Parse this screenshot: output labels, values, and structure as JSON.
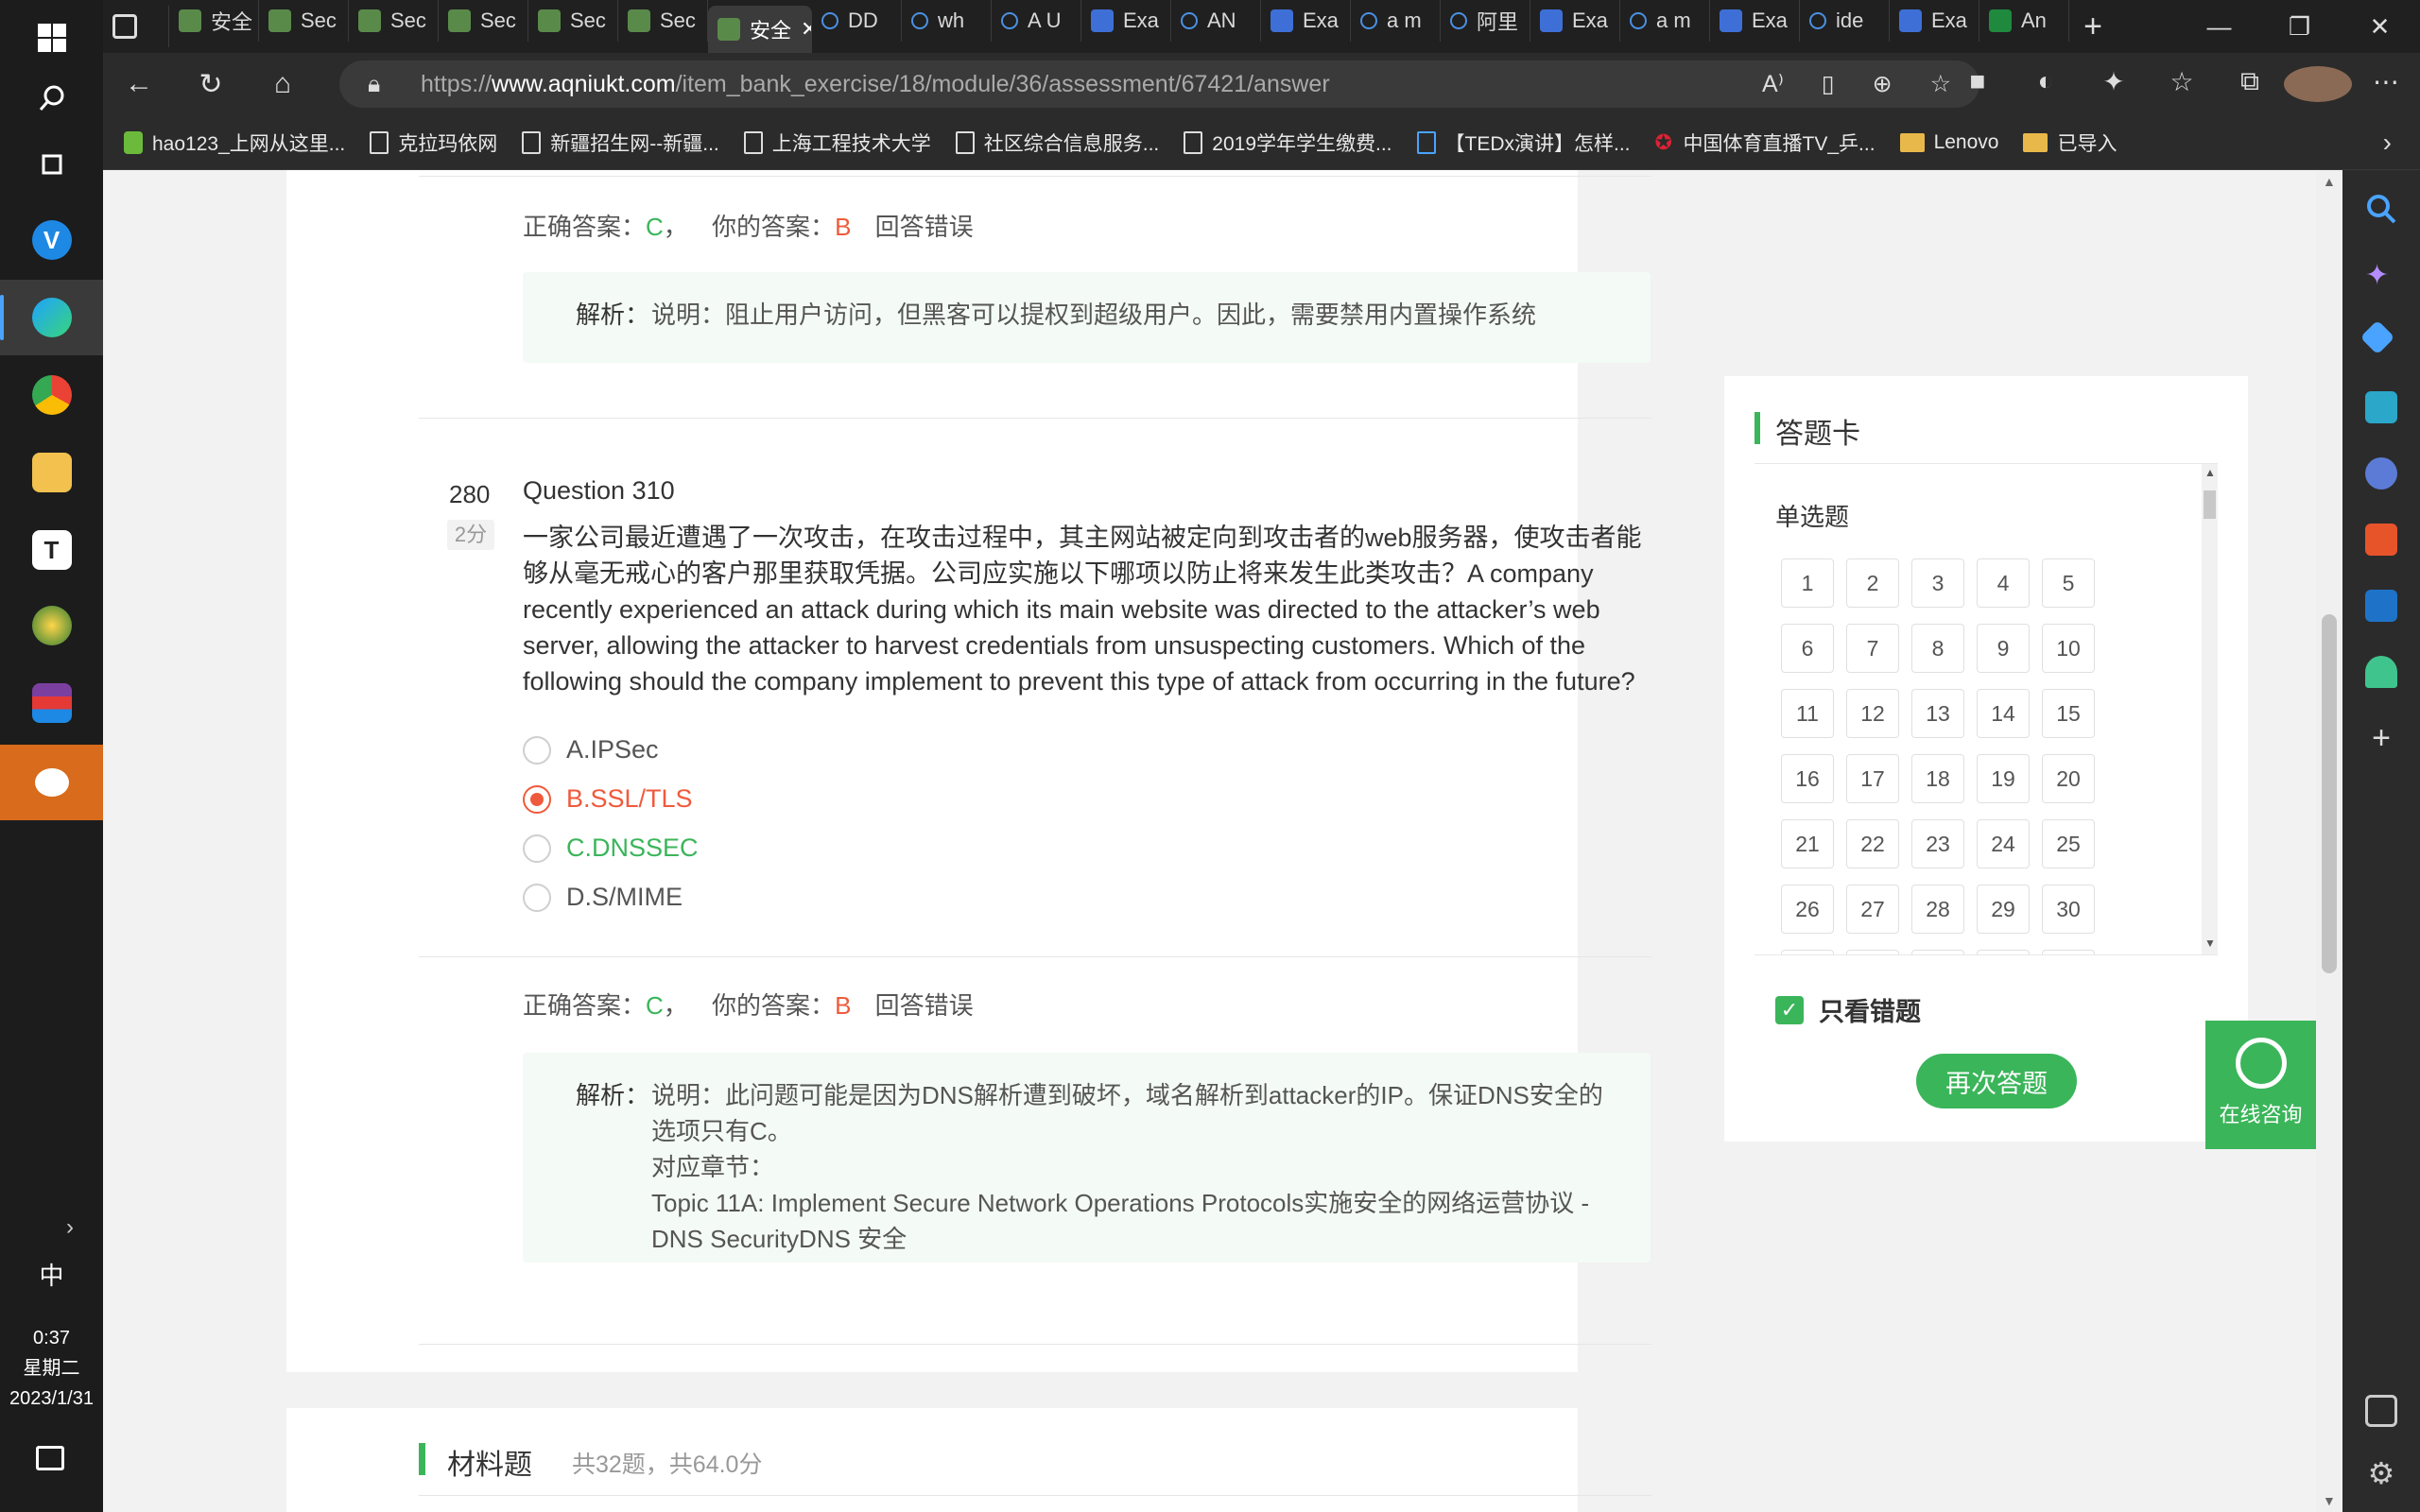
{
  "taskbar": {
    "time": "0:37",
    "weekday": "星期二",
    "date": "2023/1/31",
    "ime": "中",
    "chevron": "›"
  },
  "browser": {
    "tabs": [
      {
        "label": "安全",
        "icon": "shield-icon"
      },
      {
        "label": "Sec",
        "icon": "shield-icon"
      },
      {
        "label": "Sec",
        "icon": "shield-icon"
      },
      {
        "label": "Sec",
        "icon": "shield-icon"
      },
      {
        "label": "Sec",
        "icon": "shield-icon"
      },
      {
        "label": "Sec",
        "icon": "shield-icon"
      },
      {
        "label": "安全",
        "icon": "shield-icon",
        "active": true
      },
      {
        "label": "DD",
        "icon": "search-icon"
      },
      {
        "label": "wh",
        "icon": "search-icon"
      },
      {
        "label": "A U",
        "icon": "search-icon"
      },
      {
        "label": "Exa",
        "icon": "doc-icon"
      },
      {
        "label": "AN",
        "icon": "search-icon"
      },
      {
        "label": "Exa",
        "icon": "doc-icon"
      },
      {
        "label": "a m",
        "icon": "search-icon"
      },
      {
        "label": "阿里",
        "icon": "search-icon"
      },
      {
        "label": "Exa",
        "icon": "doc-icon"
      },
      {
        "label": "a m",
        "icon": "search-icon"
      },
      {
        "label": "Exa",
        "icon": "doc-icon"
      },
      {
        "label": "ide",
        "icon": "search-icon"
      },
      {
        "label": "Exa",
        "icon": "doc-icon"
      },
      {
        "label": "An",
        "icon": "leetcode-icon"
      }
    ],
    "url_prefix": "https://",
    "url_domain": "www.aqniukt.com",
    "url_path": "/item_bank_exercise/18/module/36/assessment/67421/answer",
    "bookmarks": [
      {
        "label": "hao123_上网从这里...",
        "icon": "hao123-icon"
      },
      {
        "label": "克拉玛依网",
        "icon": "page-icon"
      },
      {
        "label": "新疆招生网--新疆...",
        "icon": "page-icon"
      },
      {
        "label": "上海工程技术大学",
        "icon": "page-icon"
      },
      {
        "label": "社区综合信息服务...",
        "icon": "page-icon"
      },
      {
        "label": "2019学年学生缴费...",
        "icon": "page-icon"
      },
      {
        "label": "【TEDx演讲】怎样...",
        "icon": "tv-icon"
      },
      {
        "label": "中国体育直播TV_乒...",
        "icon": "cn-icon"
      },
      {
        "label": "Lenovo",
        "icon": "folder-icon"
      },
      {
        "label": "已导入",
        "icon": "folder-icon"
      }
    ]
  },
  "prev_question": {
    "correct_label": "正确答案：",
    "correct_value": "C",
    "sep": "，",
    "your_label": "你的答案：",
    "your_value": "B",
    "result": "回答错误",
    "analysis_label": "解析：",
    "analysis_text": "说明：阻止用户访问，但黑客可以提权到超级用户。因此，需要禁用内置操作系统"
  },
  "question": {
    "number": "280",
    "score": "2分",
    "title": "Question 310",
    "text": "一家公司最近遭遇了一次攻击，在攻击过程中，其主网站被定向到攻击者的web服务器，使攻击者能够从毫无戒心的客户那里获取凭据。公司应实施以下哪项以防止将来发生此类攻击？A company recently experienced an attack during which its main website was directed to the attacker’s web server, allowing the attacker to harvest credentials from unsuspecting customers. Which of the following should the company implement to prevent this type of attack from occurring in the future?",
    "options": [
      {
        "label": "A.IPSec",
        "state": "none"
      },
      {
        "label": "B.SSL/TLS",
        "state": "selected"
      },
      {
        "label": "C.DNSSEC",
        "state": "correct"
      },
      {
        "label": "D.S/MIME",
        "state": "none"
      }
    ],
    "correct_label": "正确答案：",
    "correct_value": "C",
    "sep": "，",
    "your_label": "你的答案：",
    "your_value": "B",
    "result": "回答错误",
    "analysis_label": "解析：",
    "analysis_lines": [
      "说明：此问题可能是因为DNS解析遭到破坏，域名解析到attacker的IP。保证DNS安全的选项只有C。",
      "对应章节：",
      "Topic 11A: Implement Secure Network Operations Protocols实施安全的网络运营协议 - DNS SecurityDNS 安全"
    ]
  },
  "material": {
    "title": "材料题",
    "info": "共32题，共64.0分"
  },
  "answer_card": {
    "title": "答题卡",
    "section": "单选题",
    "numbers": [
      "1",
      "2",
      "3",
      "4",
      "5",
      "6",
      "7",
      "8",
      "9",
      "10",
      "11",
      "12",
      "13",
      "14",
      "15",
      "16",
      "17",
      "18",
      "19",
      "20",
      "21",
      "22",
      "23",
      "24",
      "25",
      "26",
      "27",
      "28",
      "29",
      "30"
    ],
    "only_wrong_label": "只看错题",
    "only_wrong_checked": true,
    "retry_label": "再次答题"
  },
  "consult": {
    "label": "在线咨询"
  },
  "colors": {
    "accent_green": "#3bb55a",
    "wrong_red": "#f05a3c"
  }
}
